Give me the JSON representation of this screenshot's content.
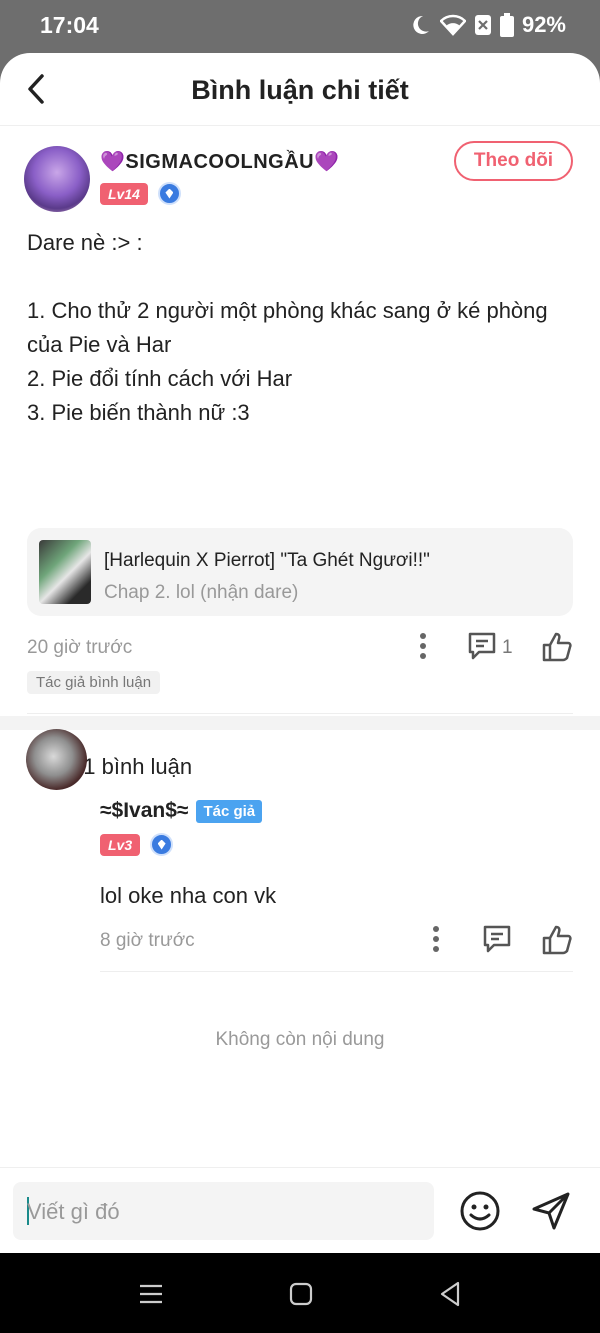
{
  "status": {
    "time": "17:04",
    "battery": "92%"
  },
  "header": {
    "title": "Bình luận chi tiết"
  },
  "post": {
    "username": "💜SIGMACOOLNGẦU💜",
    "level": "Lv14",
    "follow_label": "Theo dõi",
    "body_lines": [
      "Dare nè :> :",
      "",
      "1. Cho thử 2 người một phòng khác sang ở ké phòng của Pie và Har",
      "2. Pie đổi tính cách với Har",
      "3. Pie biến thành nữ :3"
    ],
    "ref": {
      "title": "[Harlequin X Pierrot] \"Ta Ghét Ngươi!!\"",
      "subtitle": "Chap 2. lol (nhận dare)"
    },
    "time": "20 giờ trước",
    "comment_count": "1",
    "author_tag": "Tác giả bình luận"
  },
  "comments": {
    "total_label": "Tổng 1 bình luận",
    "items": [
      {
        "username": "≈$Ivan$≈",
        "author_badge": "Tác giả",
        "level": "Lv3",
        "text": "lol oke nha con vk",
        "time": "8 giờ trước"
      }
    ],
    "end_label": "Không còn nội dung"
  },
  "composer": {
    "placeholder": "Viết gì đó"
  },
  "colors": {
    "accent": "#f06171",
    "author_badge": "#4ba3f0",
    "muted": "#999999"
  },
  "icons": [
    "back-icon",
    "more-icon",
    "comment-icon",
    "like-icon",
    "emoji-icon",
    "send-icon",
    "wifi-icon",
    "battery-icon",
    "moon-icon",
    "recents-icon",
    "home-icon",
    "back-nav-icon"
  ]
}
